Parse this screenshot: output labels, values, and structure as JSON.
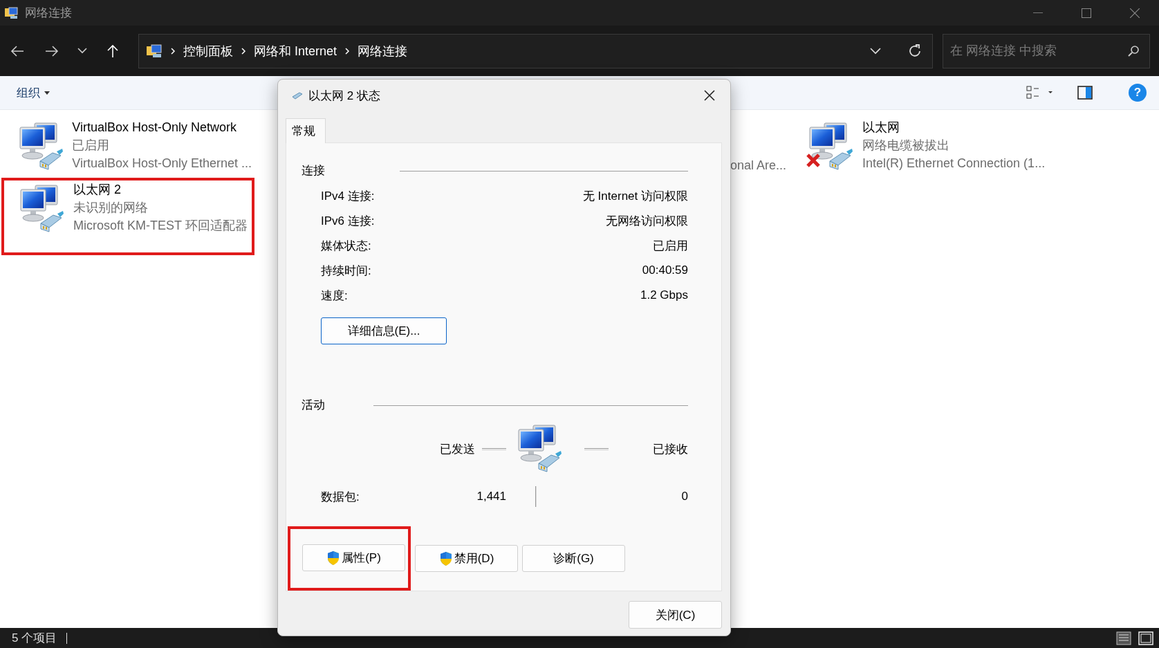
{
  "window": {
    "title": "网络连接"
  },
  "nav": {
    "breadcrumb": [
      "控制面板",
      "网络和 Internet",
      "网络连接"
    ],
    "search": {
      "placeholder": "在 网络连接 中搜索"
    }
  },
  "toolbar": {
    "organize": "组织",
    "help": "?"
  },
  "adapters_left": [
    {
      "name": "VirtualBox Host-Only Network",
      "status": "已启用",
      "device": "VirtualBox Host-Only Ethernet ...",
      "unplugged": false,
      "highlighted": false
    },
    {
      "name": "以太网 2",
      "status": "未识别的网络",
      "device": "Microsoft KM-TEST 环回适配器",
      "unplugged": false,
      "highlighted": true
    }
  ],
  "partial_adapter": {
    "device": "onal Are..."
  },
  "adapters_right": [
    {
      "name": "以太网",
      "status": "网络电缆被拔出",
      "device": "Intel(R) Ethernet Connection (1...",
      "unplugged": true,
      "highlighted": false
    }
  ],
  "dialog": {
    "title": "以太网 2 状态",
    "tabs": [
      {
        "label": "常规",
        "selected": true
      }
    ],
    "connection": {
      "heading": "连接",
      "rows": [
        {
          "label": "IPv4 连接:",
          "value": "无 Internet 访问权限"
        },
        {
          "label": "IPv6 连接:",
          "value": "无网络访问权限"
        },
        {
          "label": "媒体状态:",
          "value": "已启用"
        },
        {
          "label": "持续时间:",
          "value": "00:40:59"
        },
        {
          "label": "速度:",
          "value": "1.2 Gbps"
        }
      ],
      "details_button": "详细信息(E)..."
    },
    "activity": {
      "heading": "活动",
      "sent_label": "已发送",
      "received_label": "已接收",
      "packets_label": "数据包:",
      "packets_sent": "1,441",
      "packets_received": "0"
    },
    "buttons": [
      {
        "label": "属性(P)",
        "shield": true,
        "highlighted": true
      },
      {
        "label": "禁用(D)",
        "shield": true,
        "highlighted": false
      },
      {
        "label": "诊断(G)",
        "shield": false,
        "highlighted": false
      }
    ],
    "close_button": "关闭(C)"
  },
  "status_bar": {
    "count": "5 个项目"
  }
}
